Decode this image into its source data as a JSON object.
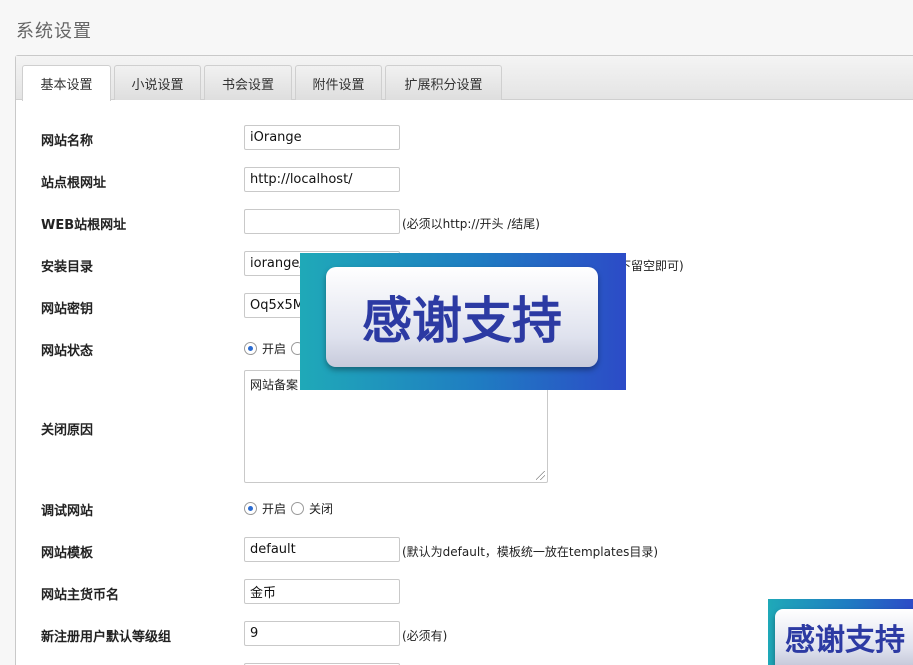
{
  "page": {
    "title": "系统设置"
  },
  "tabs": [
    {
      "label": "基本设置",
      "active": true
    },
    {
      "label": "小说设置",
      "active": false
    },
    {
      "label": "书会设置",
      "active": false
    },
    {
      "label": "附件设置",
      "active": false
    },
    {
      "label": "扩展积分设置",
      "active": false
    }
  ],
  "form": {
    "site_name": {
      "label": "网站名称",
      "value": "iOrange"
    },
    "site_root": {
      "label": "站点根网址",
      "value": "http://localhost/"
    },
    "web_root": {
      "label": "WEB站根网址",
      "value": "",
      "hint": "(必须以http://开头 /结尾)"
    },
    "install_dir": {
      "label": "安装目录",
      "value": "iorange/",
      "hint": "下留空即可)"
    },
    "site_key": {
      "label": "网站密钥",
      "value": "Oq5x5M"
    },
    "site_status": {
      "label": "网站状态",
      "option_on": "开启"
    },
    "close_reason": {
      "label": "关闭原因",
      "value": "网站备案"
    },
    "debug": {
      "label": "调试网站",
      "option_on": "开启",
      "option_off": "关闭"
    },
    "template": {
      "label": "网站模板",
      "value": "default",
      "hint": "(默认为default，模板统一放在templates目录)"
    },
    "currency": {
      "label": "网站主货币名",
      "value": "金币"
    },
    "default_group": {
      "label": "新注册用户默认等级组",
      "value": "9",
      "hint": "(必须有)"
    }
  },
  "overlays": {
    "banner_text": "感谢支持",
    "banner_text_partial": "感谢支持"
  }
}
